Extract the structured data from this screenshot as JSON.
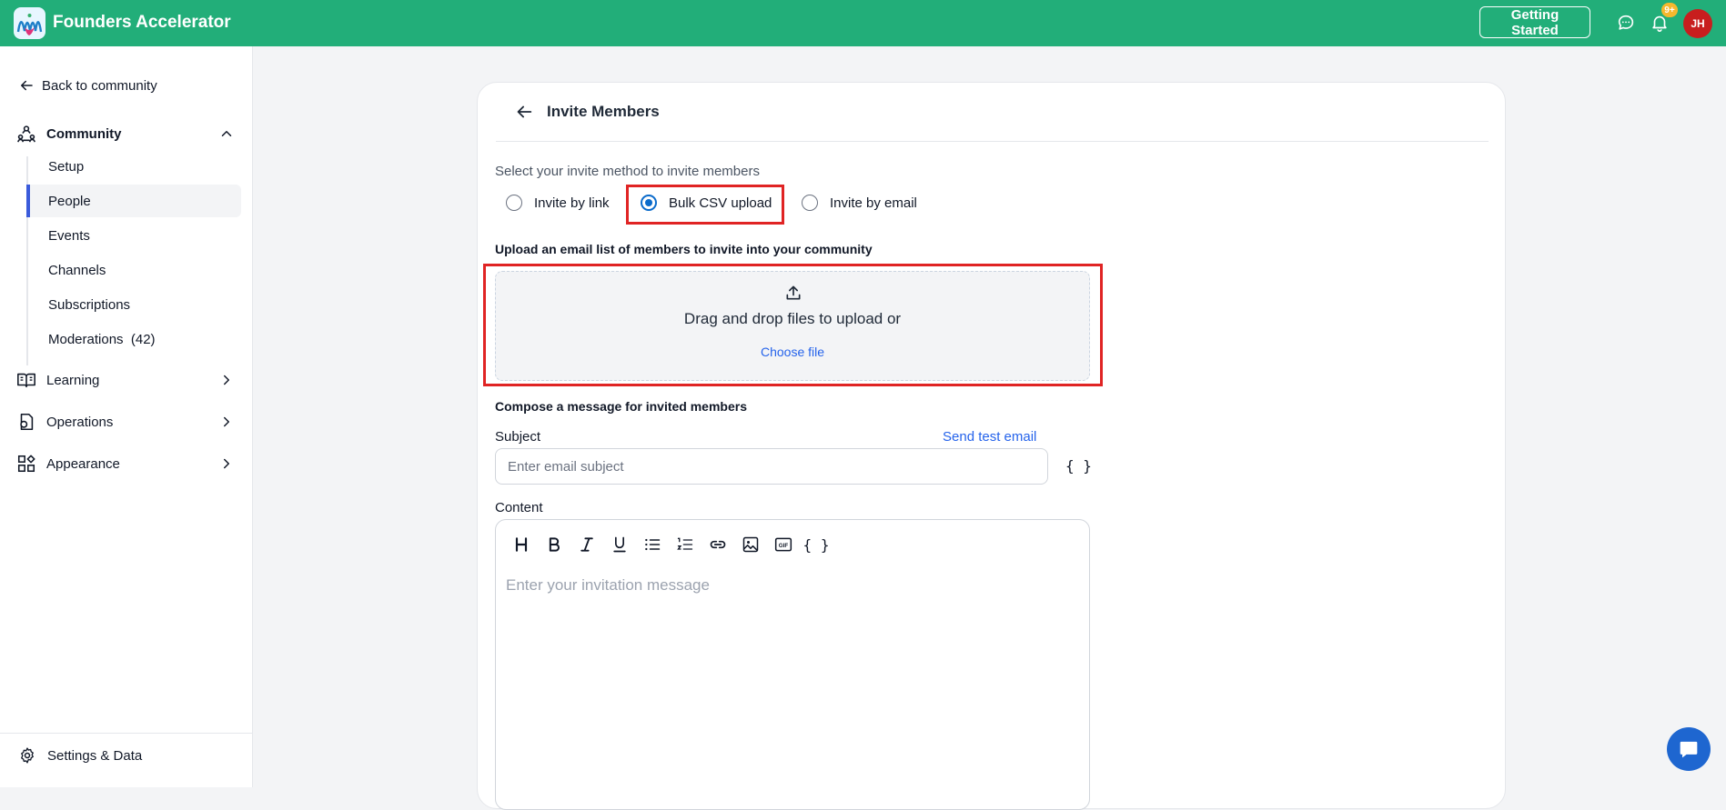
{
  "app": {
    "name": "Founders Accelerator",
    "getting_started": "Getting Started",
    "notification_badge": "9+",
    "avatar_initials": "JH",
    "brand_color": "#22ae79",
    "avatar_color": "#c81e1e"
  },
  "sidebar": {
    "back_label": "Back to community",
    "community_label": "Community",
    "community_items": [
      {
        "label": "Setup"
      },
      {
        "label": "People"
      },
      {
        "label": "Events"
      },
      {
        "label": "Channels"
      },
      {
        "label": "Subscriptions"
      },
      {
        "label": "Moderations  (42)"
      }
    ],
    "active_item": "People",
    "sections": [
      {
        "label": "Learning",
        "icon": "book-icon"
      },
      {
        "label": "Operations",
        "icon": "operations-icon"
      },
      {
        "label": "Appearance",
        "icon": "appearance-icon"
      }
    ],
    "settings_label": "Settings & Data"
  },
  "invite": {
    "title": "Invite Members",
    "method_prompt": "Select your invite method to invite members",
    "methods": [
      {
        "label": "Invite by link",
        "selected": false
      },
      {
        "label": "Bulk CSV upload",
        "selected": true
      },
      {
        "label": "Invite by email",
        "selected": false
      }
    ],
    "upload_heading": "Upload an email list of members to invite into your community",
    "dropzone_text": "Drag and drop files to upload or",
    "choose_file": "Choose file",
    "compose_heading": "Compose a message for invited members",
    "subject_label": "Subject",
    "send_test": "Send test email",
    "subject_placeholder": "Enter email subject",
    "variables_glyph": "{ }",
    "content_label": "Content",
    "content_placeholder": "Enter your invitation message",
    "toolbar_gif": "GIF"
  }
}
